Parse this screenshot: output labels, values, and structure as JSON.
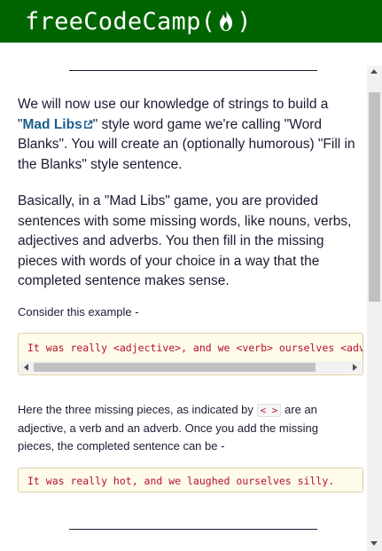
{
  "navbar": {
    "brand_text": "freeCodeCamp",
    "paren_open": "(",
    "paren_close": ")",
    "bg_color": "#006400"
  },
  "content": {
    "para1_prefix": "We will now use our knowledge of strings to build a \"",
    "para1_link": "Mad Libs",
    "para1_suffix": "\" style word game we're calling \"Word Blanks\". You will create an (optionally humorous) \"Fill in the Blanks\" style sentence.",
    "para2": "Basically, in a \"Mad Libs\" game, you are provided sentences with some missing words, like nouns, verbs, adjectives and adverbs. You then fill in the missing pieces with words of your choice in a way that the completed sentence makes sense.",
    "para3": "Consider this example -",
    "code1": "It was really <adjective>, and we <verb> ourselves <adverb>.",
    "para4_prefix": "Here the three missing pieces, as indicated by ",
    "para4_code": "< >",
    "para4_suffix": " are an adjective, a verb and an adverb. Once you add the missing pieces, the completed sentence can be -",
    "code2": "It was really hot, and we laughed ourselves silly."
  }
}
